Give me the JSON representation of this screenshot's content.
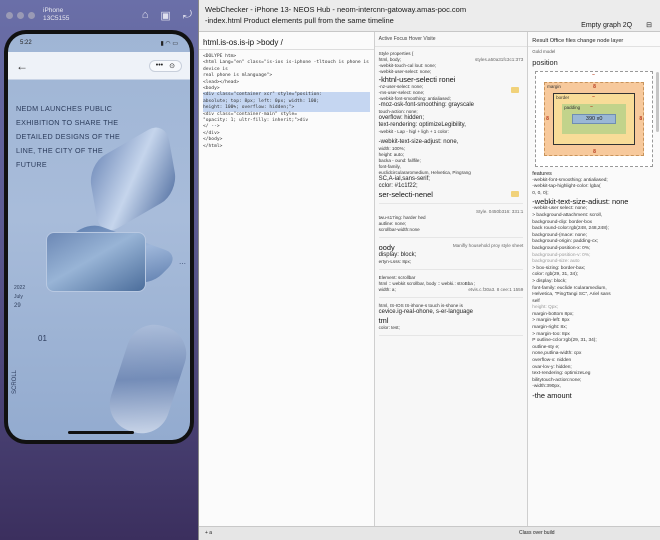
{
  "simulator": {
    "device": "iPhone",
    "os": "13C5155",
    "tool_icons": [
      "home-icon",
      "screenshot-icon",
      "rotate-icon"
    ]
  },
  "phone": {
    "time": "5:22",
    "status_icons": "▮ ◠ ▭",
    "capsule_menu": "•••",
    "capsule_close": "⊙",
    "headline": "NEDM LAUNCHES PUBLIC EXHIBITION TO SHARE THE DETAILED DESIGNS OF THE LINE, THE CITY OF THE FUTURE",
    "date_year": "2022",
    "date_month": "July",
    "date_day": "29",
    "index": "01",
    "scroll_label": "SCROLL"
  },
  "devtools": {
    "title_line1": "WebChecker - iPhone 13- NEOS Hub - neom-intercnn-gatoway.amas-poc.com",
    "title_line2": "-index.html Product elements pull from the same timeline",
    "toolbar_right": "Empty graph 2Q",
    "breadcrumb": "html.is-os.is-ip >body /",
    "dom_lines": [
      "<DOLYPE htm>",
      "<html Lang=\"en\" class=\"is-ios is-iphone -tltouch is phone is device is",
      "real phone is mlanguage\">",
      "  <lead></head>",
      "  <body>",
      "    <div class=\"container xcr\" style=\"position:",
      "    absolute; top: 8px; left: 0px; width: 100;",
      "    height: 100%; overflow: hidden;\">",
      "      <div class=\"container-main\" style=",
      "      \"opacity: 1; ultr-filly: inherit;\">div",
      "      </ -->",
      "    </div>",
      "  </body>",
      "</html>"
    ],
    "styles_head": "Active Focus Hover Visite",
    "styles_props": "Style properties {",
    "rules": [
      {
        "sel": "html, body;",
        "src": "styles.a50a31fc3c1:373"
      },
      {
        "line": "-webkit-touch-cal lout: none;"
      },
      {
        "line": "-webkit-user-select: none;"
      },
      {
        "big": "-khtnl-user-selecti ronei"
      },
      {
        "line": "-nz-user-select: none;"
      },
      {
        "line": "-ms-user-select: none;"
      },
      {
        "line": "-webkit-font-smoothing: antialiased;"
      },
      {
        "med": "-moz-osk-font-smoothing: grayscale"
      },
      {
        "line": "touch-action: none;"
      },
      {
        "med": "overflow: hidden;"
      },
      {
        "med": "text-rendering: optimizeLegibility,"
      },
      {
        "line": "-webkit - Lap - higl + ligh + 1 color:"
      }
    ],
    "rules2": [
      "-webkit-text-size-adjust: none,",
      "width: 100%;",
      "height: auto;",
      "backa - ound: fallfile;",
      "font-family,",
      "euclidcirculararomedium, Helvetica, Pingrang",
      "SC,A-ial,sans-serif;",
      "cclor: #1c1f22;"
    ],
    "rule2_big": "ser-selecti-nenel",
    "rule3_src": "Style. 0450b316: 331:1",
    "rule3_lines": [
      "twu-s17ing: harder hed",
      "autline: none;",
      "scrollbar-width:none"
    ],
    "body_sel": "oody",
    "body_src": "Manifly household proy style sheet",
    "body_lines": [
      "display: block;",
      "ertyn-Lsss: 8px;"
    ],
    "element_head": "Element: scrollbar",
    "element_sel": "html :: webkit scrollbar, body :: webki.: stroBba ;",
    "element_src": "etvis.c.f30a3. 8 cee:1 1559",
    "element_lines": [
      "width: a;"
    ],
    "html_head": "html, IS-IOS IS-iIhone-s touch is-shone is",
    "html_head2": "cevice.ig-real-ohone, s-er-language",
    "html_sel": "tml",
    "html_lines": [
      "color: test;"
    ],
    "boxmodel_head": "Result Office files change node layer",
    "boxmodel_sub": "Gold model",
    "position_label": "position",
    "position_val": "–",
    "margin_label": "margin",
    "margin_val": "8",
    "border_label": "border",
    "border_val": "–",
    "padding_label": "padding",
    "padding_val": "–",
    "content_size": "390 x0",
    "features_head": "features",
    "features_lines": [
      "-webkit-font-smoothing: antialiased;",
      "-webkit-tap-highlight-color: lgba(",
      "  0, 0, 0);"
    ],
    "features_big": "-webkit-text-size-adiust: none",
    "features_lines2": [
      "-webkit-user select: none;",
      "> background-attachment: scroll,",
      "  background-clip: border-box",
      "",
      "  back round-color:rgb(248, 248,248);",
      "",
      "background-(mace: none;",
      "background-origin: padding-cx;",
      "  background-position-x: 0%;",
      "  background-position-v: 0%;",
      "  background-size: auto",
      "> box-sizing: border-bax;",
      "color: rgb(29, 31, 34);",
      "> display: block;",
      "font-family: euclide rcularamedium,",
      "  Helvetica, \"PingTangi SC\", Ariel sans",
      "  self",
      "  height: Qpx;",
      "  margin-bottom 8px;",
      "> margin-left: 8px",
      "margin-right: 8x;",
      "> margin-too: 8px",
      "P outline-cclor:rgb(29, 31, 34);",
      "outline-sty e;",
      "none,putlina-width: cpx",
      "overflow-x: nidden",
      "  ovar-lov-y: hidden;",
      "text-rendering: optimizeLeg",
      "bilitytouch-action:none;",
      "-width:390px,"
    ],
    "features_big2": "-the amount",
    "features_corner": "Canceling a grouping",
    "bottom_left": "+ a",
    "bottom_mid": "Class over build"
  }
}
